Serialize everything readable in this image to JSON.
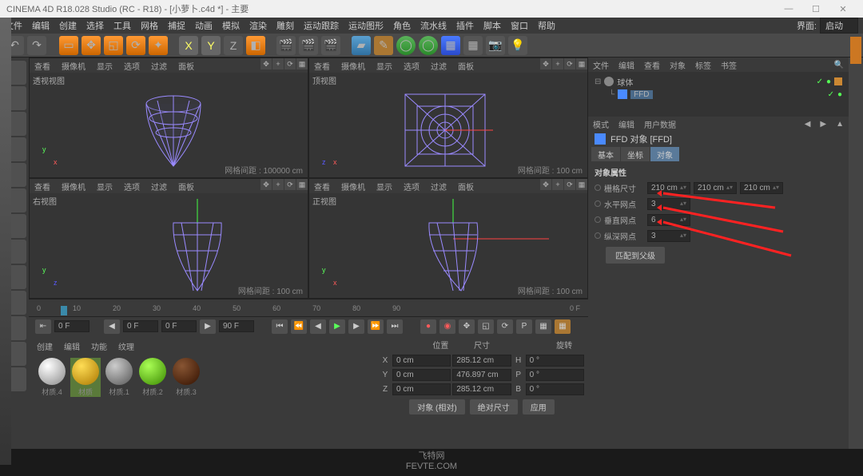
{
  "titlebar": {
    "text": "CINEMA 4D R18.028 Studio (RC - R18) - [小萝卜.c4d *] - 主要"
  },
  "menu": {
    "items": [
      "文件",
      "编辑",
      "创建",
      "选择",
      "工具",
      "网格",
      "捕捉",
      "动画",
      "模拟",
      "渲染",
      "雕刻",
      "运动跟踪",
      "运动图形",
      "角色",
      "流水线",
      "插件",
      "脚本",
      "窗口",
      "帮助"
    ],
    "layout_label": "界面:",
    "layout_value": "启动"
  },
  "viewport_menu": {
    "items": [
      "查看",
      "摄像机",
      "显示",
      "选项",
      "过滤",
      "面板"
    ]
  },
  "viewports": {
    "tl": {
      "label": "透视视图",
      "info_label": "网格间距 :",
      "info_value": "100000 cm"
    },
    "tr": {
      "label": "顶视图",
      "info_label": "网格间距 :",
      "info_value": "100 cm"
    },
    "bl": {
      "label": "右视图",
      "info_label": "网格间距 :",
      "info_value": "100 cm"
    },
    "br": {
      "label": "正视图",
      "info_label": "网格间距 :",
      "info_value": "100 cm"
    }
  },
  "timeline": {
    "ticks": [
      "0",
      "10",
      "20",
      "30",
      "40",
      "50",
      "60",
      "70",
      "80",
      "90"
    ],
    "end1": "0 F",
    "end2": "0 F"
  },
  "playback": {
    "start": "0 F",
    "cur1": "0 F",
    "cur2": "0 F",
    "end": "90 F"
  },
  "materials": {
    "tabs": [
      "创建",
      "编辑",
      "功能",
      "纹理"
    ],
    "items": [
      "材质.4",
      "材质",
      "材质.1",
      "材质.2",
      "材质.3"
    ]
  },
  "coords": {
    "headers": [
      "位置",
      "尺寸",
      "旋转"
    ],
    "rows": [
      {
        "axis": "X",
        "pos": "0 cm",
        "size": "285.12 cm",
        "rot_label": "H",
        "rot": "0 °"
      },
      {
        "axis": "Y",
        "pos": "0 cm",
        "size": "476.897 cm",
        "rot_label": "P",
        "rot": "0 °"
      },
      {
        "axis": "Z",
        "pos": "0 cm",
        "size": "285.12 cm",
        "rot_label": "B",
        "rot": "0 °"
      }
    ],
    "mode1": "对象 (相对)",
    "mode2": "绝对尺寸",
    "apply": "应用"
  },
  "objpanel": {
    "tabs": [
      "文件",
      "编辑",
      "查看",
      "对象",
      "标签",
      "书签"
    ],
    "tree": {
      "parent": "球体",
      "child": "FFD"
    }
  },
  "attr": {
    "tabs": [
      "模式",
      "编辑",
      "用户数据"
    ],
    "title": "FFD 对象 [FFD]",
    "subtabs": [
      "基本",
      "坐标",
      "对象"
    ],
    "section": "对象属性",
    "grid_label": "栅格尺寸",
    "grid": [
      "210 cm",
      "210 cm",
      "210 cm"
    ],
    "rows": [
      {
        "label": "水平网点",
        "value": "3"
      },
      {
        "label": "垂直网点",
        "value": "6"
      },
      {
        "label": "纵深网点",
        "value": "3"
      }
    ],
    "fit_button": "匹配到父级"
  },
  "watermark": {
    "line1": "飞特网",
    "line2": "FEVTE.COM"
  }
}
